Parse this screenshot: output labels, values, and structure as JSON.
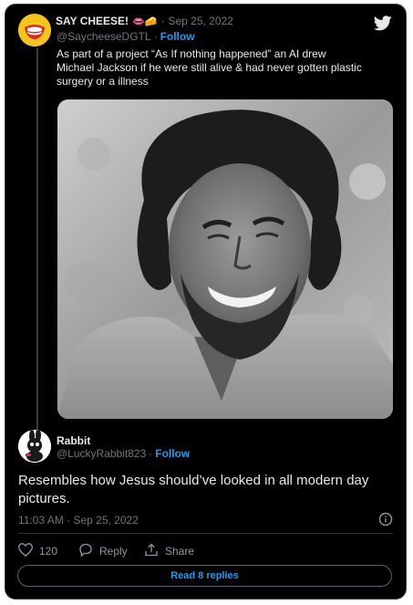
{
  "tweet": {
    "author_name": "SAY CHEESE!",
    "author_emojis": "👄🧀",
    "separator": "·",
    "date": "Sep 25, 2022",
    "handle": "@SaycheeseDGTL",
    "follow_label": "Follow",
    "text": "As part of a project “As If nothing happened” an AI drew Michael Jackson if he were still alive & had never gotten plastic surgery or a illness"
  },
  "reply": {
    "author_name": "Rabbit",
    "handle": "@LuckyRabbit823",
    "separator": "·",
    "follow_label": "Follow",
    "text": "Resembles how Jesus should’ve looked in all modern day pictures.",
    "timestamp": "11:03 AM · Sep 25, 2022"
  },
  "actions": {
    "like_count": "120",
    "reply_label": "Reply",
    "share_label": "Share"
  },
  "read_more_label": "Read 8 replies",
  "icons": {
    "brand": "twitter-bird-icon",
    "info": "info-icon",
    "like": "heart-icon",
    "reply": "reply-bubble-icon",
    "share": "share-icon"
  },
  "colors": {
    "background": "#000000",
    "text": "#e7e9ea",
    "muted": "#71767b",
    "accent": "#1d9bf0",
    "border": "#3a3d40"
  }
}
